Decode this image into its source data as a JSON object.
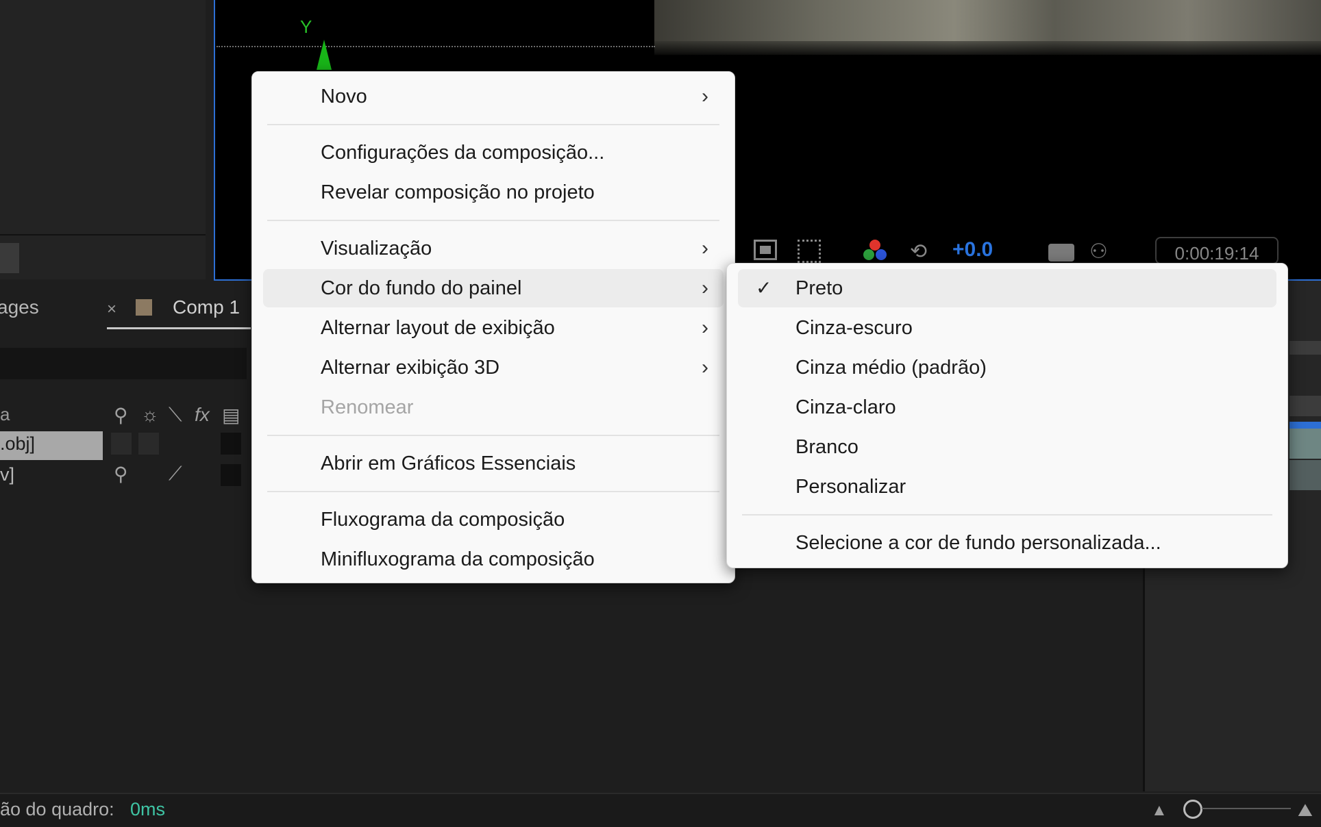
{
  "viewer": {
    "axis_label": "Y",
    "exposure_value": "+0.0",
    "timecode": "0:00:19:14"
  },
  "panel": {
    "tab_images_label": "ages",
    "tab_close_label": "×",
    "tab_comp_label": "Comp 1"
  },
  "timeline": {
    "header_label": "a",
    "rows": [
      ".obj]",
      "v]"
    ],
    "switch_icons": [
      "shy-icon",
      "solo-icon",
      "quality-icon",
      "effects-icon",
      "frame-blend-icon"
    ],
    "fx_label": "fx"
  },
  "status": {
    "label": "ão do quadro:",
    "value": "0ms"
  },
  "main_menu": {
    "items": [
      {
        "label": "Novo",
        "submenu": true
      },
      {
        "label": "Configurações da composição..."
      },
      {
        "label": "Revelar composição no projeto"
      },
      {
        "label": "Visualização",
        "submenu": true
      },
      {
        "label": "Cor do fundo do painel",
        "submenu": true,
        "highlighted": true
      },
      {
        "label": "Alternar layout de exibição",
        "submenu": true
      },
      {
        "label": "Alternar exibição 3D",
        "submenu": true
      },
      {
        "label": "Renomear",
        "disabled": true
      },
      {
        "label": "Abrir em Gráficos Essenciais"
      },
      {
        "label": "Fluxograma da composição"
      },
      {
        "label": "Minifluxograma da composição"
      }
    ],
    "chevron": "›"
  },
  "sub_menu": {
    "items": [
      {
        "label": "Preto",
        "checked": true,
        "highlighted": true
      },
      {
        "label": "Cinza-escuro"
      },
      {
        "label": "Cinza médio (padrão)"
      },
      {
        "label": "Cinza-claro"
      },
      {
        "label": "Branco"
      },
      {
        "label": "Personalizar"
      },
      {
        "label": "Selecione a cor de fundo personalizada..."
      }
    ],
    "check_glyph": "✓"
  },
  "colors": {
    "accent_blue": "#2d6fd4",
    "status_green": "#3fc4a4",
    "axis_green": "#28c228",
    "menu_bg": "#f9f9f9",
    "menu_highlight": "#ececec"
  }
}
